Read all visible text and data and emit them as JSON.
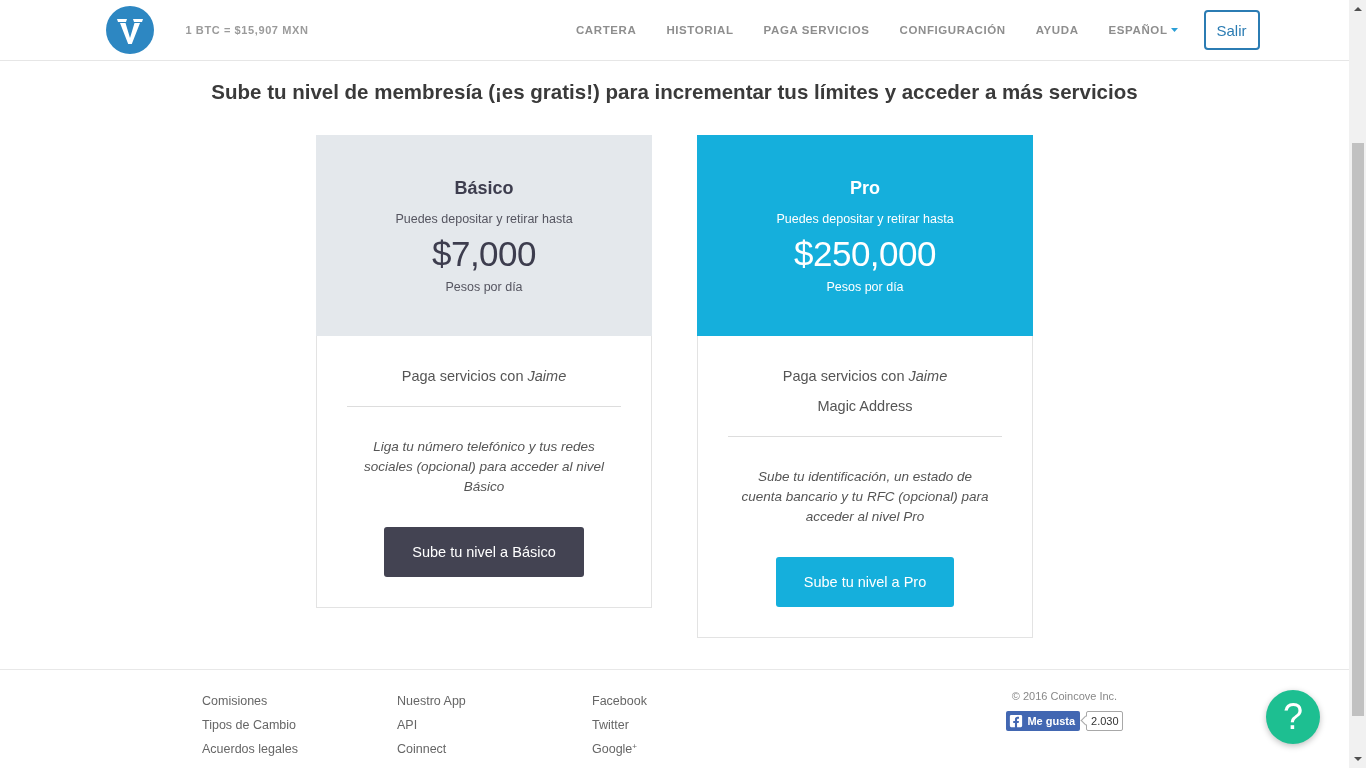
{
  "header": {
    "rate": "1 BTC = $15,907 MXN",
    "nav": [
      {
        "label": "CARTERA",
        "kind": "link"
      },
      {
        "label": "HISTORIAL",
        "kind": "link"
      },
      {
        "label": "PAGA SERVICIOS",
        "kind": "link"
      },
      {
        "label": "CONFIGURACIÓN",
        "kind": "link"
      },
      {
        "label": "AYUDA",
        "kind": "link"
      },
      {
        "label": "ESPAÑOL",
        "kind": "dropdown"
      }
    ],
    "logout_button": "Salir"
  },
  "heading": "Sube tu nivel de membresía (¡es gratis!) para incrementar tus límites y acceder a más servicios",
  "plans": [
    {
      "kind": "basic",
      "title": "Básico",
      "limit_label": "Puedes depositar y retirar hasta",
      "amount": "$7,000",
      "period": "Pesos por día",
      "features": [
        "Paga servicios con *Jaime*"
      ],
      "requirement": "Liga tu número telefónico y tus redes sociales (opcional) para acceder al nivel Básico",
      "button": "Sube tu nivel a Básico"
    },
    {
      "kind": "pro",
      "title": "Pro",
      "limit_label": "Puedes depositar y retirar hasta",
      "amount": "$250,000",
      "period": "Pesos por día",
      "features": [
        "Paga servicios con *Jaime*",
        "Magic Address"
      ],
      "requirement": "Sube tu identificación, un estado de cuenta bancario y tu RFC (opcional) para acceder al nivel Pro",
      "button": "Sube tu nivel a Pro"
    }
  ],
  "footer": {
    "columns": [
      {
        "links": [
          "Comisiones",
          "Tipos de Cambio",
          "Acuerdos legales"
        ]
      },
      {
        "links": [
          "Nuestro App",
          "API",
          "Coinnect"
        ]
      },
      {
        "links": [
          "Facebook",
          "Twitter",
          "Google$^{+}$"
        ]
      }
    ],
    "copyright": "© 2016 Coincove Inc.",
    "like_button": {
      "label": "Me gusta",
      "count": "2.030"
    }
  },
  "help_button": {
    "label": "?"
  }
}
